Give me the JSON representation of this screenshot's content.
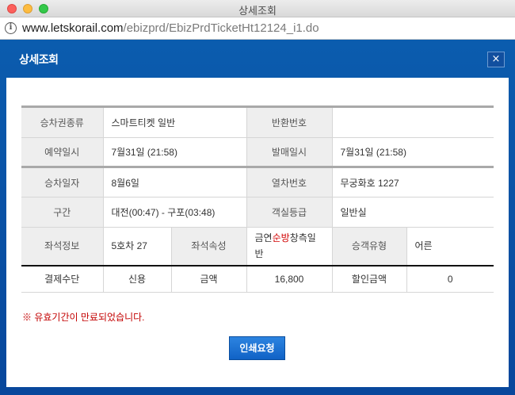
{
  "window": {
    "title": "상세조회"
  },
  "browser": {
    "url_host": "www.letskorail.com",
    "url_path": "/ebizprd/EbizPrdTicketHt12124_i1.do"
  },
  "popup": {
    "title": "상세조회",
    "close_label": "×"
  },
  "details": {
    "ticket_type_label": "승차권종류",
    "ticket_type": "스마트티켓 일반",
    "refund_no_label": "반환번호",
    "refund_no": "",
    "reserve_date_label": "예약일시",
    "reserve_date": "7월31일 (21:58)",
    "issue_date_label": "발매일시",
    "issue_date": "7월31일 (21:58)",
    "ride_date_label": "승차일자",
    "ride_date": "8월6일",
    "train_no_label": "열차번호",
    "train_no": "무궁화호 1227",
    "section_label": "구간",
    "section": "대전(00:47) - 구포(03:48)",
    "class_label": "객실등급",
    "class": "일반실",
    "seat_label": "좌석정보",
    "seat": "5호차 27",
    "seat_attr_label": "좌석속성",
    "seat_attr_a": "금연",
    "seat_attr_b": "순방",
    "seat_attr_c": "창측일반",
    "passenger_type_label": "승객유형",
    "passenger_type": "어른",
    "payment_label": "결제수단",
    "payment": "신용",
    "amount_label": "금액",
    "amount": "16,800",
    "discount_label": "할인금액",
    "discount": "0"
  },
  "notice": "※ 유효기간이 만료되었습니다.",
  "print_button": "인쇄요청"
}
